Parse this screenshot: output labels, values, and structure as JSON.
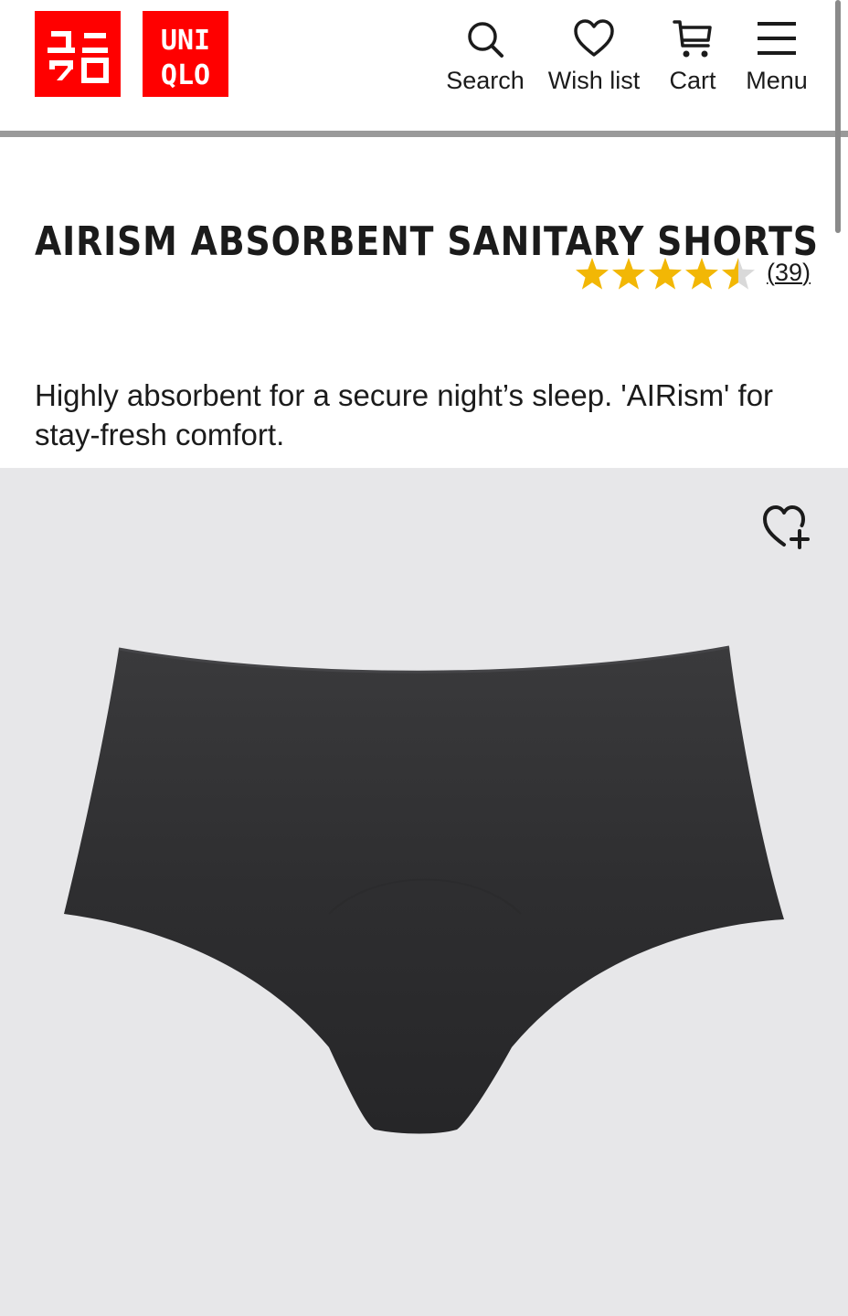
{
  "header": {
    "logo_text_top": "UNI",
    "logo_text_bottom": "QLO",
    "logo_color": "#ff0000",
    "nav": [
      {
        "label": "Search",
        "icon": "search-icon"
      },
      {
        "label": "Wish list",
        "icon": "heart-icon"
      },
      {
        "label": "Cart",
        "icon": "cart-icon"
      },
      {
        "label": "Menu",
        "icon": "hamburger-icon"
      }
    ]
  },
  "product": {
    "title": "AIRISM ABSORBENT SANITARY SHORTS",
    "rating": 4.5,
    "rating_max": 5,
    "star_color": "#f2b705",
    "review_count_text": "39",
    "description": "Highly absorbent for a secure night’s sleep. 'AIRism' for stay-fresh comfort.",
    "image": {
      "subject": "black sanitary shorts",
      "background_color": "#e7e7e9"
    },
    "wishlist_add_icon": "heart-plus-icon"
  }
}
